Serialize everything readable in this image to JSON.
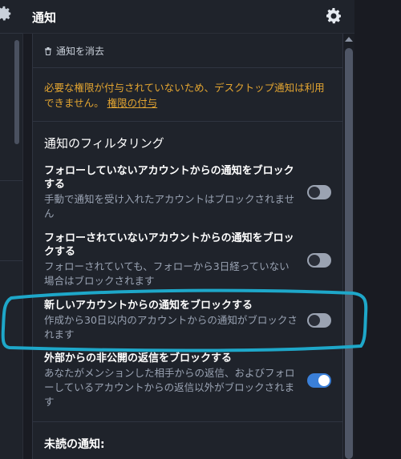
{
  "header": {
    "title": "通知",
    "settings_icon": "gear-icon"
  },
  "clear": {
    "label": "通知を消去",
    "icon": "trash-icon"
  },
  "warning": {
    "text": "必要な権限が付与されていないため、デスクトップ通知は利用できません。",
    "link": "権限の付与"
  },
  "filter": {
    "title": "通知のフィルタリング",
    "items": [
      {
        "label": "フォローしていないアカウントからの通知をブロックする",
        "hint": "手動で通知を受け入れたアカウントはブロックされません",
        "enabled": false
      },
      {
        "label": "フォローされていないアカウントからの通知をブロックする",
        "hint": "フォローされていても、フォローから3日経っていない場合はブロックされます",
        "enabled": false
      },
      {
        "label": "新しいアカウントからの通知をブロックする",
        "hint": "作成から30日以内のアカウントからの通知がブロックされます",
        "enabled": false
      },
      {
        "label": "外部からの非公開の返信をブロックする",
        "hint": "あなたがメンションした相手からの返信、およびフォローしているアカウントからの返信以外がブロックされます",
        "enabled": true
      }
    ]
  },
  "unread": {
    "title": "未読の通知:"
  },
  "colors": {
    "accent": "#3a7fd8",
    "warning": "#e3a531",
    "annotation": "#1ea7c9"
  }
}
